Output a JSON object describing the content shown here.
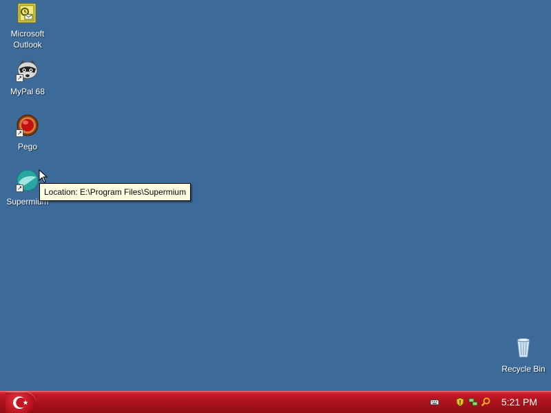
{
  "desktop": {
    "icons": [
      {
        "label": "Microsoft\nOutlook",
        "icon": "outlook-icon"
      },
      {
        "label": "MyPal 68",
        "icon": "raccoon-icon",
        "shortcut": true
      },
      {
        "label": "Pego",
        "icon": "pego-icon",
        "shortcut": true
      },
      {
        "label": "Supermium",
        "icon": "supermium-icon",
        "shortcut": true
      },
      {
        "label": "Recycle Bin",
        "icon": "recycle-bin-icon"
      }
    ],
    "tooltip": "Location: E:\\Program Files\\Supermium"
  },
  "taskbar": {
    "start_icon": "turkish-flag-icon",
    "tray_icons": [
      "keyboard-icon",
      "security-shield-icon",
      "network-icon",
      "search-icon"
    ],
    "clock": "5:21 PM"
  },
  "colors": {
    "desktop_background": "#3c6a99",
    "taskbar": "#b0141e",
    "tooltip_background": "#ffffe1"
  }
}
